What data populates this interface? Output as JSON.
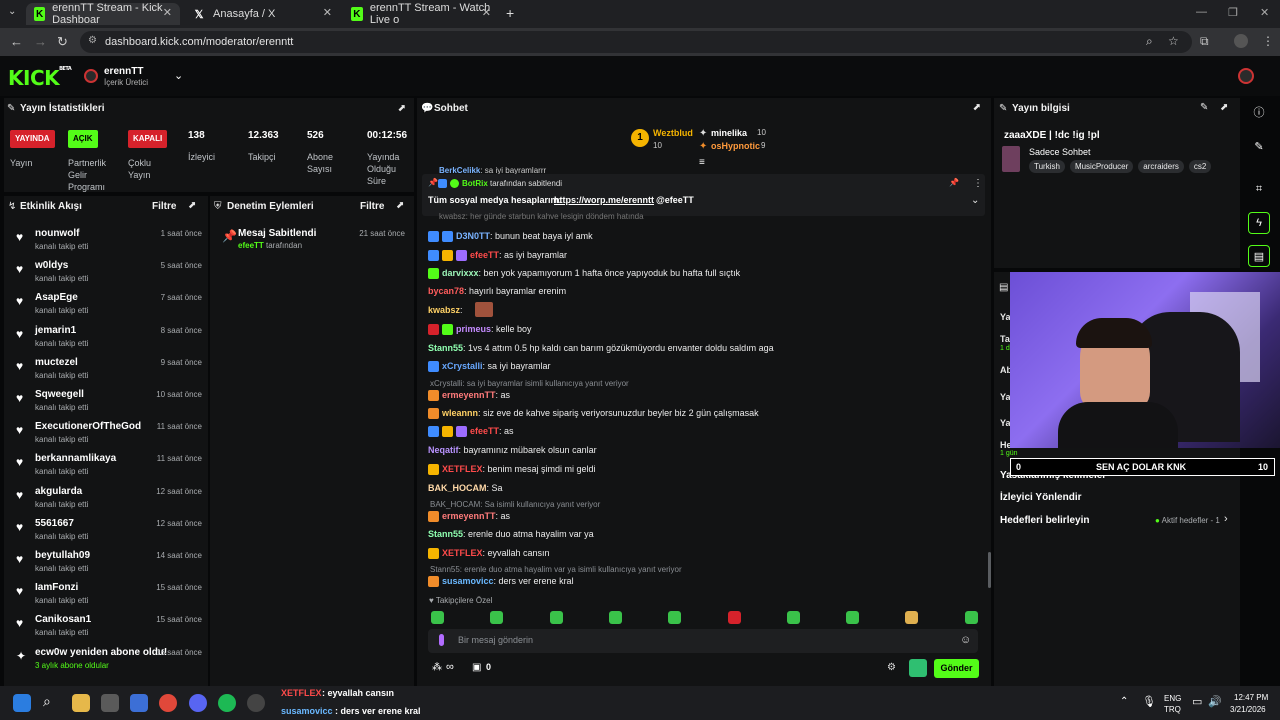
{
  "browser": {
    "tabs": [
      {
        "title": "erennTT Stream - Kick Dashboar"
      },
      {
        "title": "Anasayfa / X"
      },
      {
        "title": "erennTT Stream - Watch Live o"
      }
    ],
    "url": "dashboard.kick.com/moderator/erenntt",
    "new_tab": "+"
  },
  "header": {
    "logo": "KICK",
    "logo_sup": "BETA",
    "user": "erennTT",
    "role": "İçerik Üretici"
  },
  "stats": {
    "title": "Yayın İstatistikleri",
    "items": [
      {
        "badge": "YAYINDA",
        "label": "Yayın"
      },
      {
        "badge": "AÇIK",
        "label": "Partnerlik Gelir Programı"
      },
      {
        "badge": "KAPALI",
        "label": "Çoklu Yayın"
      },
      {
        "value": "138",
        "label": "İzleyici"
      },
      {
        "value": "12.363",
        "label": "Takipçi"
      },
      {
        "value": "526",
        "label": "Abone Sayısı"
      },
      {
        "value": "00:12:56",
        "label": "Yayında Olduğu Süre"
      }
    ]
  },
  "activity": {
    "title": "Etkinlik Akışı",
    "filter": "Filtre",
    "items": [
      {
        "name": "nounwolf",
        "sub": "kanalı takip etti",
        "time": "1 saat önce"
      },
      {
        "name": "w0ldys",
        "sub": "kanalı takip etti",
        "time": "5 saat önce"
      },
      {
        "name": "AsapEge",
        "sub": "kanalı takip etti",
        "time": "7 saat önce"
      },
      {
        "name": "jemarin1",
        "sub": "kanalı takip etti",
        "time": "8 saat önce"
      },
      {
        "name": "muctezel",
        "sub": "kanalı takip etti",
        "time": "9 saat önce"
      },
      {
        "name": "Sqweegell",
        "sub": "kanalı takip etti",
        "time": "10 saat önce"
      },
      {
        "name": "ExecutionerOfTheGod",
        "sub": "kanalı takip etti",
        "time": "11 saat önce"
      },
      {
        "name": "berkannamlikaya",
        "sub": "kanalı takip etti",
        "time": "11 saat önce"
      },
      {
        "name": "akgularda",
        "sub": "kanalı takip etti",
        "time": "12 saat önce"
      },
      {
        "name": "5561667",
        "sub": "kanalı takip etti",
        "time": "12 saat önce"
      },
      {
        "name": "beytullah09",
        "sub": "kanalı takip etti",
        "time": "14 saat önce"
      },
      {
        "name": "IamFonzi",
        "sub": "kanalı takip etti",
        "time": "15 saat önce"
      },
      {
        "name": "Canikosan1",
        "sub": "kanalı takip etti",
        "time": "15 saat önce"
      },
      {
        "name": "ecw0w yeniden abone oldu!",
        "sub": "3 aylık abone oldular",
        "time": "16 saat önce"
      }
    ]
  },
  "moderation": {
    "title": "Denetim Eylemleri",
    "filter": "Filtre",
    "item_title": "Mesaj Sabitlendi",
    "item_user": "efeeTT",
    "item_suffix": "tarafından",
    "item_time": "21 saat önce"
  },
  "chat": {
    "title": "Sohbet",
    "leader1": {
      "name": "Weztblud",
      "count": "10"
    },
    "leader2": {
      "name": "minelika",
      "count": "10"
    },
    "leader3": {
      "name": "osHypnotic",
      "count": "9"
    },
    "pinned_by": "BotRix",
    "pinned_by_suffix": "tarafından sabitlendi",
    "pinned_text": "Tüm sosyal medya hesaplarım:",
    "pinned_link": "https://worp.me/erenntt",
    "pinned_tag": "@efeeTT",
    "messages": [
      {
        "user": "D3N0TT",
        "color": "#7ab3ff",
        "text": ": bunun beat baya iyl amk"
      },
      {
        "user": "efeeTT",
        "color": "#ff4b4b",
        "text": ": as iyi bayramlar"
      },
      {
        "user": "darvixxx",
        "color": "#9cf5b8",
        "text": ": ben yok yapamıyorum 1 hafta önce yapıyoduk bu hafta full sıçtık"
      },
      {
        "user": "bycan78",
        "color": "#ff5c5c",
        "text": ": hayırlı bayramlar erenim"
      },
      {
        "user": "kwabsz",
        "color": "#ffd166",
        "text": ":"
      },
      {
        "user": "primeus",
        "color": "#c48bff",
        "text": ": kelle boy"
      },
      {
        "user": "Stann55",
        "color": "#8fffb0",
        "text": ": 1vs 4 attım 0.5 hp kaldı can barım gözükmüyordu envanter doldu saldım aga"
      },
      {
        "user": "xCrystalli",
        "color": "#68a8ff",
        "text": ": sa iyi bayramlar"
      },
      {
        "user": "ermeyennTT",
        "color": "#ff7b7b",
        "text": ": as"
      },
      {
        "user": "wleannn",
        "color": "#ffd166",
        "text": ": siz eve de kahve sipariş veriyorsunuzdur beyler biz 2 gün çalışmasak"
      },
      {
        "user": "efeeTT",
        "color": "#ff4b4b",
        "text": ": as"
      },
      {
        "user": "Neqatif",
        "color": "#b993ff",
        "text": ": bayramınız mübarek olsun canlar"
      },
      {
        "user": "XETFLEX",
        "color": "#ff4b4b",
        "text": ": benim mesaj şimdi mi geldi"
      },
      {
        "user": "BAK_HOCAM",
        "color": "#ffd9a8",
        "text": ": Sa"
      },
      {
        "user": "ermeyennTT",
        "color": "#ff7b7b",
        "text": ": as"
      },
      {
        "user": "Stann55",
        "color": "#8fffb0",
        "text": ": erenle duo atma hayalim var ya"
      },
      {
        "user": "XETFLEX",
        "color": "#ff4b4b",
        "text": ": eyvallah cansın"
      },
      {
        "user": "susamovicc",
        "color": "#6ab8ff",
        "text": ": ders ver erene kral"
      }
    ],
    "top_partial_user": "BerkCelikk",
    "top_partial_text": ": sa iyi bayramlarrr",
    "hidden_partial": "kwabsz: her günde starbun kahve lesigin döndem hatında",
    "replies": [
      "xCrystalli: sa iyi bayramlar isimli kullanıcıya yanıt veriyor",
      "BAK_HOCAM: Sa isimli kullanıcıya yanıt veriyor",
      "Stann55: erenle duo atma hayalim var ya isimli kullanıcıya yanıt veriyor"
    ],
    "followers_only": "Takipçilere Özel",
    "input_placeholder": "Bir mesaj gönderin",
    "send": "Gönder",
    "inf": "∞",
    "gift_count": "0"
  },
  "info": {
    "title": "Yayın bilgisi",
    "stream_title": "zaaaXDE | !dc !ig !pl",
    "category": "Sadece Sohbet",
    "tags": [
      "Turkish",
      "MusicProducer",
      "arcraiders",
      "cs2"
    ],
    "rows": [
      "Yasaklanmış kelimeler",
      "İzleyici Yönlendir",
      "Hedefleri belirleyin"
    ],
    "goals": "Aktif hedefler - 1",
    "partial_labels": [
      "Yay",
      "Tal",
      "Ab",
      "Yal",
      "Yaj",
      "He"
    ],
    "partial_sub": [
      "1 dk",
      "1 gün"
    ]
  },
  "overlay": {
    "left": "0",
    "text": "SEN AÇ DOLAR KNK",
    "right": "10"
  },
  "taskbar": {
    "notif1_user": "XETFLEX",
    "notif1_text": ": eyvallah cansın",
    "notif2_user": "susamovicc",
    "notif2_text": ": ders ver erene kral",
    "lang1": "ENG",
    "lang2": "TRQ",
    "time": "12:47 PM",
    "date": "3/21/2026"
  }
}
